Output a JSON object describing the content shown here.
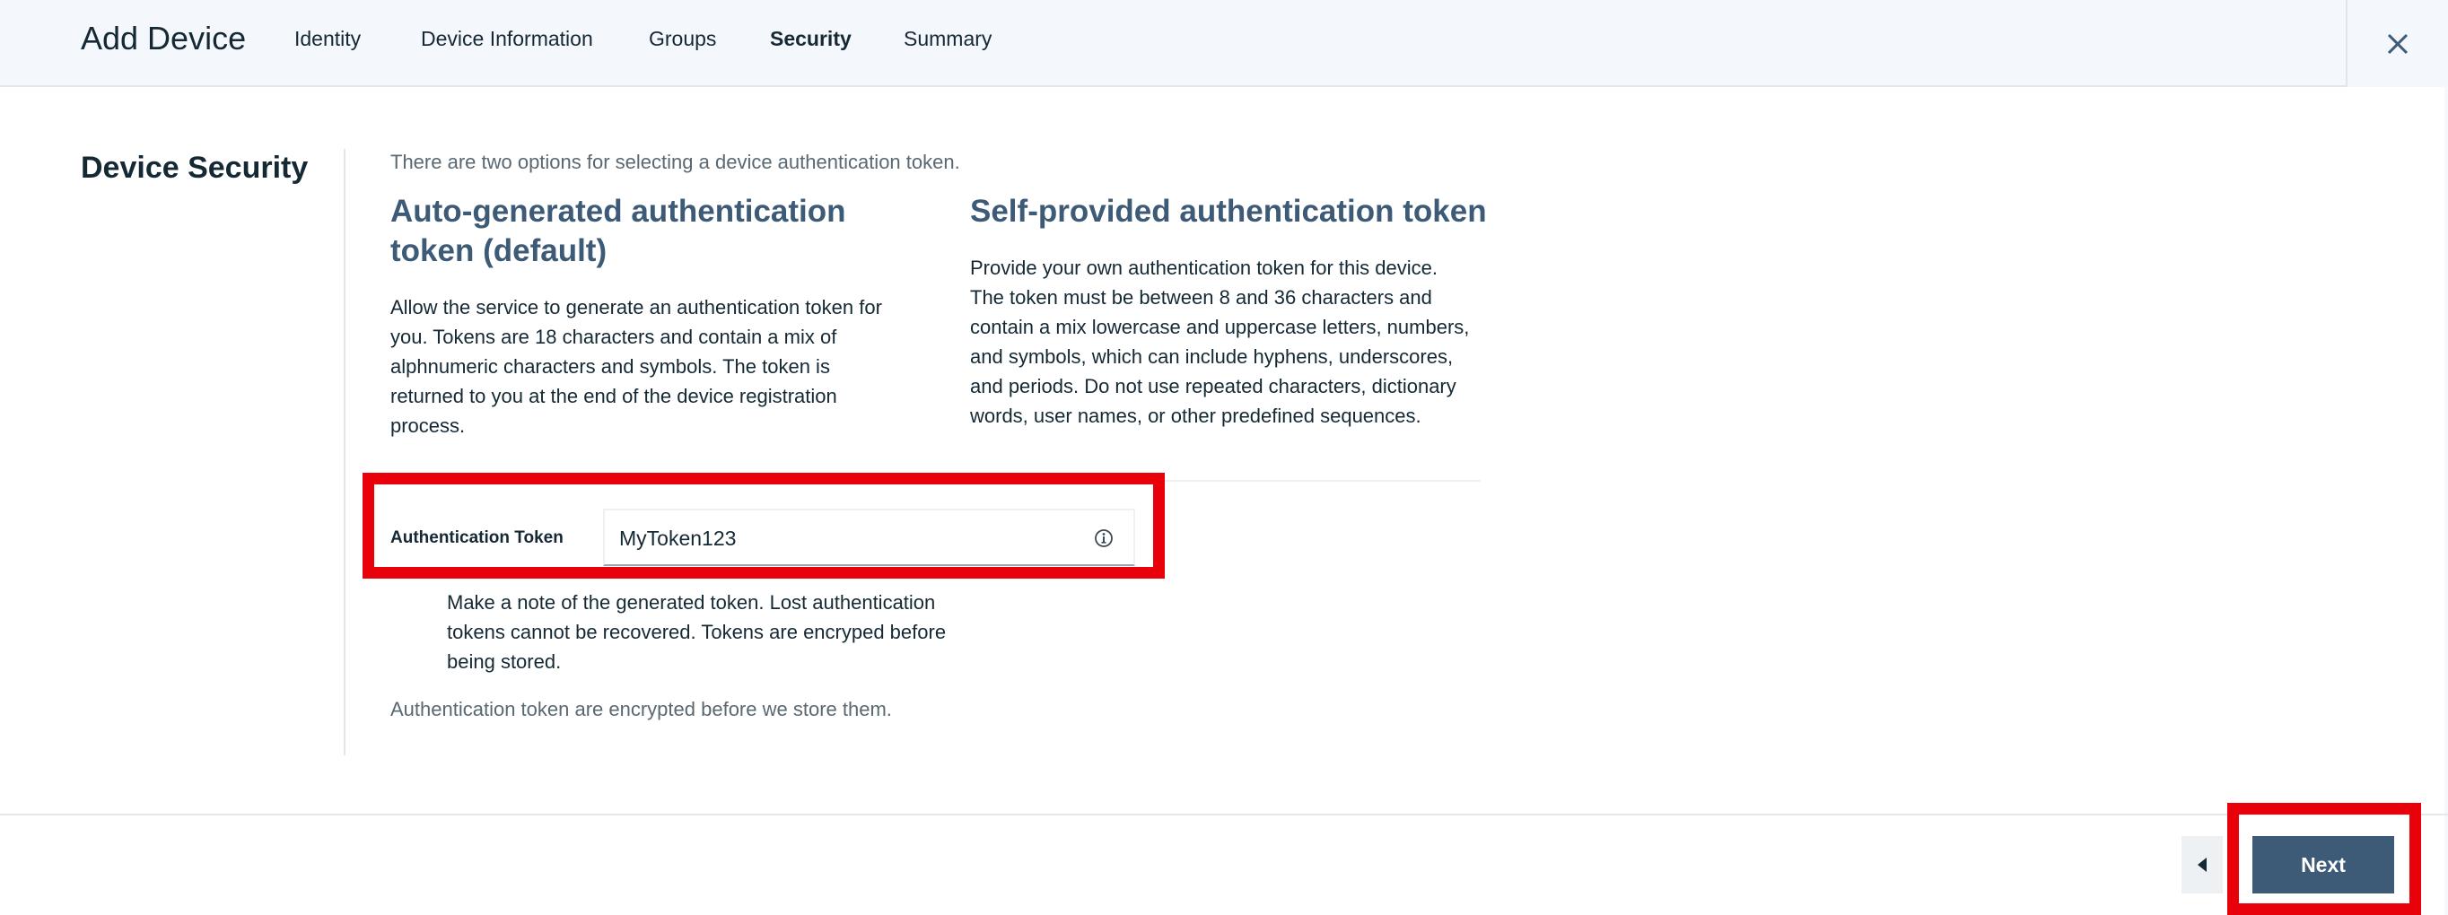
{
  "header": {
    "title": "Add Device",
    "tabs": [
      {
        "label": "Identity",
        "active": false
      },
      {
        "label": "Device Information",
        "active": false
      },
      {
        "label": "Groups",
        "active": false
      },
      {
        "label": "Security",
        "active": true
      },
      {
        "label": "Summary",
        "active": false
      }
    ],
    "close_icon": "close-icon"
  },
  "section": {
    "title": "Device Security",
    "intro": "There are two options for selecting a device authentication token."
  },
  "auto_option": {
    "title_line1": "Auto-generated authentication",
    "title_line2": "token (default)",
    "lines": [
      "Allow the service to generate an authentication token for",
      "you. Tokens are 18 characters and contain a mix of",
      "alphnumeric characters and symbols. The token is",
      "returned to you at the end of the device registration",
      "process."
    ]
  },
  "self_option": {
    "title": "Self-provided authentication token",
    "lines": [
      "Provide your own authentication token for this device.",
      "The token must be between 8 and 36 characters and",
      "contain a mix lowercase and uppercase letters, numbers,",
      "and symbols, which can include hyphens, underscores,",
      "and periods. Do not use repeated characters, dictionary",
      "words, user names, or other predefined sequences."
    ]
  },
  "token_field": {
    "label": "Authentication Token",
    "value": "MyToken123",
    "icon": "info-icon"
  },
  "note_lines": [
    "Make a note of the generated token. Lost authentication",
    "tokens cannot be recovered. Tokens are encryped before",
    "being stored."
  ],
  "footnote": "Authentication token are encrypted before we store them.",
  "footer": {
    "back_icon": "caret-left-icon",
    "next_label": "Next"
  },
  "colors": {
    "accent": "#3d5a76",
    "highlight": "#e8000b",
    "header_bg": "#f4f7fb"
  }
}
